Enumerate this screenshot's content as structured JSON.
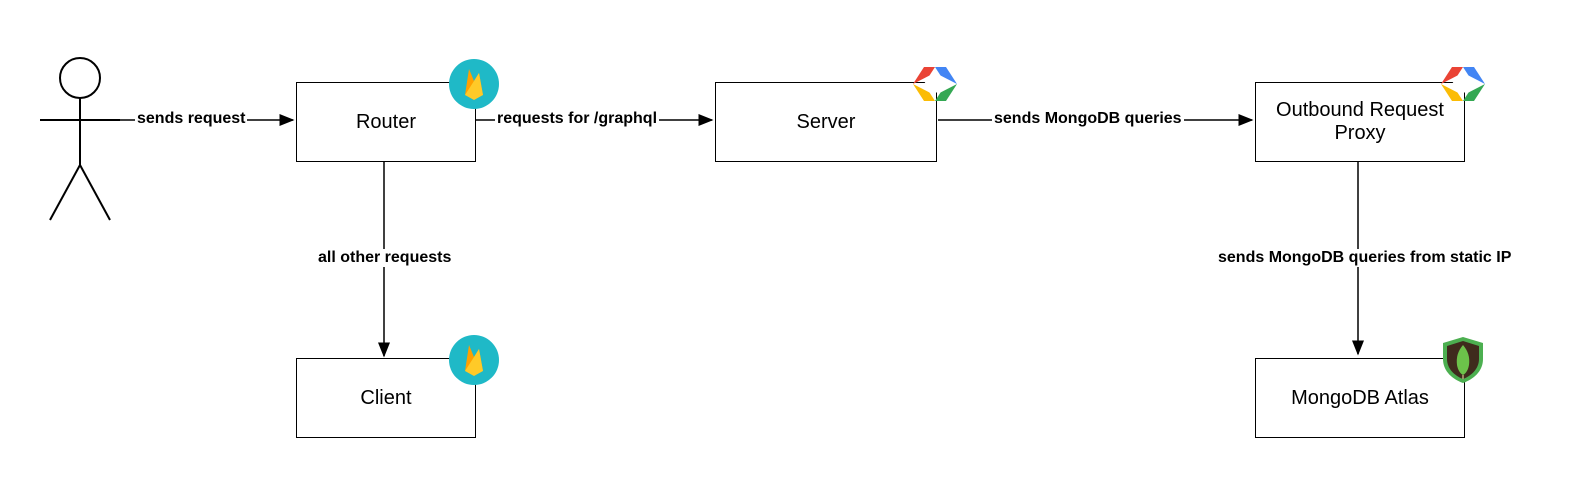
{
  "diagram": {
    "actor": {
      "label": "actor"
    },
    "nodes": {
      "router": {
        "label": "Router",
        "icon": "firebase"
      },
      "client": {
        "label": "Client",
        "icon": "firebase"
      },
      "server": {
        "label": "Server",
        "icon": "gcp"
      },
      "proxy": {
        "label": "Outbound Request Proxy",
        "icon": "gcp"
      },
      "atlas": {
        "label": "MongoDB Atlas",
        "icon": "mongodb"
      }
    },
    "edges": {
      "actor_router": {
        "label": "sends request"
      },
      "router_server": {
        "label": "requests for /graphql"
      },
      "router_client": {
        "label": "all other requests"
      },
      "server_proxy": {
        "label": "sends MongoDB queries"
      },
      "proxy_atlas": {
        "label": "sends MongoDB queries from static IP"
      }
    }
  },
  "colors": {
    "firebase_bg": "#1fb9c7",
    "firebase_flame": "#ffa000",
    "gcp_red": "#ea4335",
    "gcp_blue": "#4285f4",
    "gcp_yellow": "#fbbc05",
    "gcp_green": "#34a853",
    "mongo_shield_outer": "#4caf50",
    "mongo_shield_inner": "#3f2b1d",
    "mongo_leaf": "#6cc24a"
  }
}
